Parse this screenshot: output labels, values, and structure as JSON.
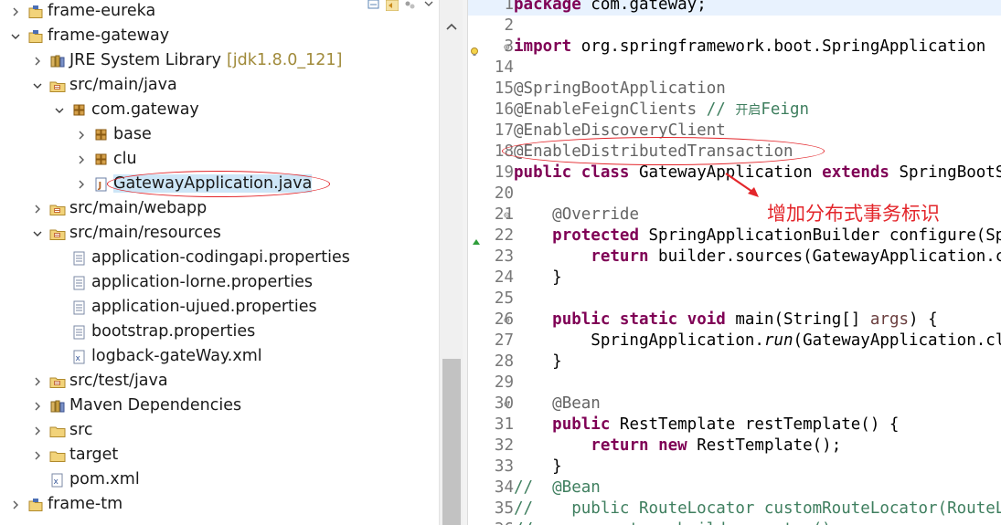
{
  "explorer": {
    "items": [
      {
        "label": "frame-eureka",
        "decoration": "",
        "icon": "project-icon",
        "level": 0,
        "expanded": false
      },
      {
        "label": "frame-gateway",
        "decoration": "",
        "icon": "project-icon",
        "level": 0,
        "expanded": true
      },
      {
        "label": "JRE System Library",
        "decoration": "[jdk1.8.0_121]",
        "icon": "library-icon",
        "level": 1,
        "expanded": false
      },
      {
        "label": "src/main/java",
        "decoration": "",
        "icon": "source-folder-icon",
        "level": 1,
        "expanded": true
      },
      {
        "label": "com.gateway",
        "decoration": "",
        "icon": "package-icon",
        "level": 2,
        "expanded": true
      },
      {
        "label": "base",
        "decoration": "",
        "icon": "package-icon",
        "level": 3,
        "expanded": false
      },
      {
        "label": "clu",
        "decoration": "",
        "icon": "package-icon",
        "level": 3,
        "expanded": false
      },
      {
        "label": "GatewayApplication.java",
        "decoration": "",
        "icon": "java-file-icon",
        "level": 3,
        "expanded": false,
        "selected": true
      },
      {
        "label": "src/main/webapp",
        "decoration": "",
        "icon": "source-folder-icon",
        "level": 1,
        "expanded": false
      },
      {
        "label": "src/main/resources",
        "decoration": "",
        "icon": "source-folder-icon",
        "level": 1,
        "expanded": true
      },
      {
        "label": "application-codingapi.properties",
        "decoration": "",
        "icon": "properties-file-icon",
        "level": 2,
        "leaf": true
      },
      {
        "label": "application-lorne.properties",
        "decoration": "",
        "icon": "properties-file-icon",
        "level": 2,
        "leaf": true
      },
      {
        "label": "application-ujued.properties",
        "decoration": "",
        "icon": "properties-file-icon",
        "level": 2,
        "leaf": true
      },
      {
        "label": "bootstrap.properties",
        "decoration": "",
        "icon": "properties-file-icon",
        "level": 2,
        "leaf": true
      },
      {
        "label": "logback-gateWay.xml",
        "decoration": "",
        "icon": "xml-file-icon",
        "level": 2,
        "leaf": true
      },
      {
        "label": "src/test/java",
        "decoration": "",
        "icon": "source-folder-icon",
        "level": 1,
        "expanded": false
      },
      {
        "label": "Maven Dependencies",
        "decoration": "",
        "icon": "library-icon",
        "level": 1,
        "expanded": false
      },
      {
        "label": "src",
        "decoration": "",
        "icon": "folder-icon",
        "level": 1,
        "expanded": false
      },
      {
        "label": "target",
        "decoration": "",
        "icon": "folder-icon",
        "level": 1,
        "expanded": false
      },
      {
        "label": "pom.xml",
        "decoration": "",
        "icon": "xml-file-icon",
        "level": 1,
        "leaf": true
      },
      {
        "label": "frame-tm",
        "decoration": "",
        "icon": "project-icon",
        "level": 0,
        "expanded": false
      }
    ]
  },
  "editor": {
    "lines": [
      {
        "n": "1",
        "fold": "",
        "marker": "",
        "tokens": [
          [
            "kw",
            "package"
          ],
          [
            "pl",
            " com.gateway;"
          ]
        ]
      },
      {
        "n": "2",
        "fold": "",
        "marker": "",
        "tokens": []
      },
      {
        "n": "3",
        "fold": "⊕",
        "marker": "warning",
        "tokens": [
          [
            "kw",
            "import"
          ],
          [
            "pl",
            " org.springframework.boot.SpringApplication"
          ]
        ]
      },
      {
        "n": "14",
        "fold": "",
        "marker": "",
        "tokens": []
      },
      {
        "n": "15",
        "fold": "",
        "marker": "",
        "tokens": [
          [
            "ann",
            "@SpringBootApplication"
          ]
        ]
      },
      {
        "n": "16",
        "fold": "",
        "marker": "",
        "tokens": [
          [
            "ann",
            "@EnableFeignClients"
          ],
          [
            "pl",
            " "
          ],
          [
            "cmt",
            "// "
          ],
          [
            "cn",
            "开启"
          ],
          [
            "cmt",
            "Feign"
          ]
        ]
      },
      {
        "n": "17",
        "fold": "",
        "marker": "",
        "tokens": [
          [
            "ann",
            "@EnableDiscoveryClient"
          ]
        ]
      },
      {
        "n": "18",
        "fold": "",
        "marker": "",
        "tokens": [
          [
            "ann",
            "@EnableDistributedTransaction"
          ]
        ]
      },
      {
        "n": "19",
        "fold": "",
        "marker": "",
        "tokens": [
          [
            "kw",
            "public"
          ],
          [
            "pl",
            " "
          ],
          [
            "kw",
            "class"
          ],
          [
            "pl",
            " GatewayApplication "
          ],
          [
            "kw",
            "extends"
          ],
          [
            "pl",
            " SpringBootServletInitializer {"
          ]
        ]
      },
      {
        "n": "20",
        "fold": "",
        "marker": "",
        "tokens": []
      },
      {
        "n": "21",
        "fold": "⊖",
        "marker": "",
        "tokens": [
          [
            "pl",
            "    "
          ],
          [
            "ann",
            "@Override"
          ]
        ]
      },
      {
        "n": "22",
        "fold": "",
        "marker": "override",
        "tokens": [
          [
            "pl",
            "    "
          ],
          [
            "kw",
            "protected"
          ],
          [
            "pl",
            " SpringApplicationBuilder configure(SpringApplicationBuilder builder) {"
          ]
        ]
      },
      {
        "n": "23",
        "fold": "",
        "marker": "",
        "tokens": [
          [
            "pl",
            "        "
          ],
          [
            "kw",
            "return"
          ],
          [
            "pl",
            " builder.sources(GatewayApplication.class);"
          ]
        ]
      },
      {
        "n": "24",
        "fold": "",
        "marker": "",
        "tokens": [
          [
            "pl",
            "    }"
          ]
        ]
      },
      {
        "n": "25",
        "fold": "",
        "marker": "",
        "tokens": []
      },
      {
        "n": "26",
        "fold": "⊖",
        "marker": "",
        "tokens": [
          [
            "pl",
            "    "
          ],
          [
            "kw",
            "public"
          ],
          [
            "pl",
            " "
          ],
          [
            "kw",
            "static"
          ],
          [
            "pl",
            " "
          ],
          [
            "kw",
            "void"
          ],
          [
            "pl",
            " main(String[] "
          ],
          [
            "param",
            "args"
          ],
          [
            "pl",
            ") {"
          ]
        ]
      },
      {
        "n": "27",
        "fold": "",
        "marker": "",
        "tokens": [
          [
            "pl",
            "        SpringApplication."
          ],
          [
            "it",
            "run"
          ],
          [
            "pl",
            "(GatewayApplication.class, args);"
          ]
        ]
      },
      {
        "n": "28",
        "fold": "",
        "marker": "",
        "tokens": [
          [
            "pl",
            "    }"
          ]
        ]
      },
      {
        "n": "29",
        "fold": "",
        "marker": "",
        "tokens": []
      },
      {
        "n": "30",
        "fold": "⊖",
        "marker": "",
        "tokens": [
          [
            "pl",
            "    "
          ],
          [
            "ann",
            "@Bean"
          ]
        ]
      },
      {
        "n": "31",
        "fold": "",
        "marker": "",
        "tokens": [
          [
            "pl",
            "    "
          ],
          [
            "kw",
            "public"
          ],
          [
            "pl",
            " RestTemplate restTemplate() {"
          ]
        ]
      },
      {
        "n": "32",
        "fold": "",
        "marker": "",
        "tokens": [
          [
            "pl",
            "        "
          ],
          [
            "kw",
            "return"
          ],
          [
            "pl",
            " "
          ],
          [
            "kw",
            "new"
          ],
          [
            "pl",
            " RestTemplate();"
          ]
        ]
      },
      {
        "n": "33",
        "fold": "",
        "marker": "",
        "tokens": [
          [
            "pl",
            "    }"
          ]
        ]
      },
      {
        "n": "34",
        "fold": "",
        "marker": "",
        "tokens": [
          [
            "cmt",
            "//  @Bean"
          ]
        ]
      },
      {
        "n": "35",
        "fold": "",
        "marker": "",
        "tokens": [
          [
            "cmt",
            "//    public RouteLocator customRouteLocator(RouteLocatorBuilder builder) {"
          ]
        ]
      },
      {
        "n": "36",
        "fold": "",
        "marker": "",
        "tokens": [
          [
            "cmt",
            "//        return builder.routes()"
          ]
        ]
      }
    ]
  },
  "annotation": {
    "text": "增加分布式事务标识",
    "color": "#e3262b"
  }
}
